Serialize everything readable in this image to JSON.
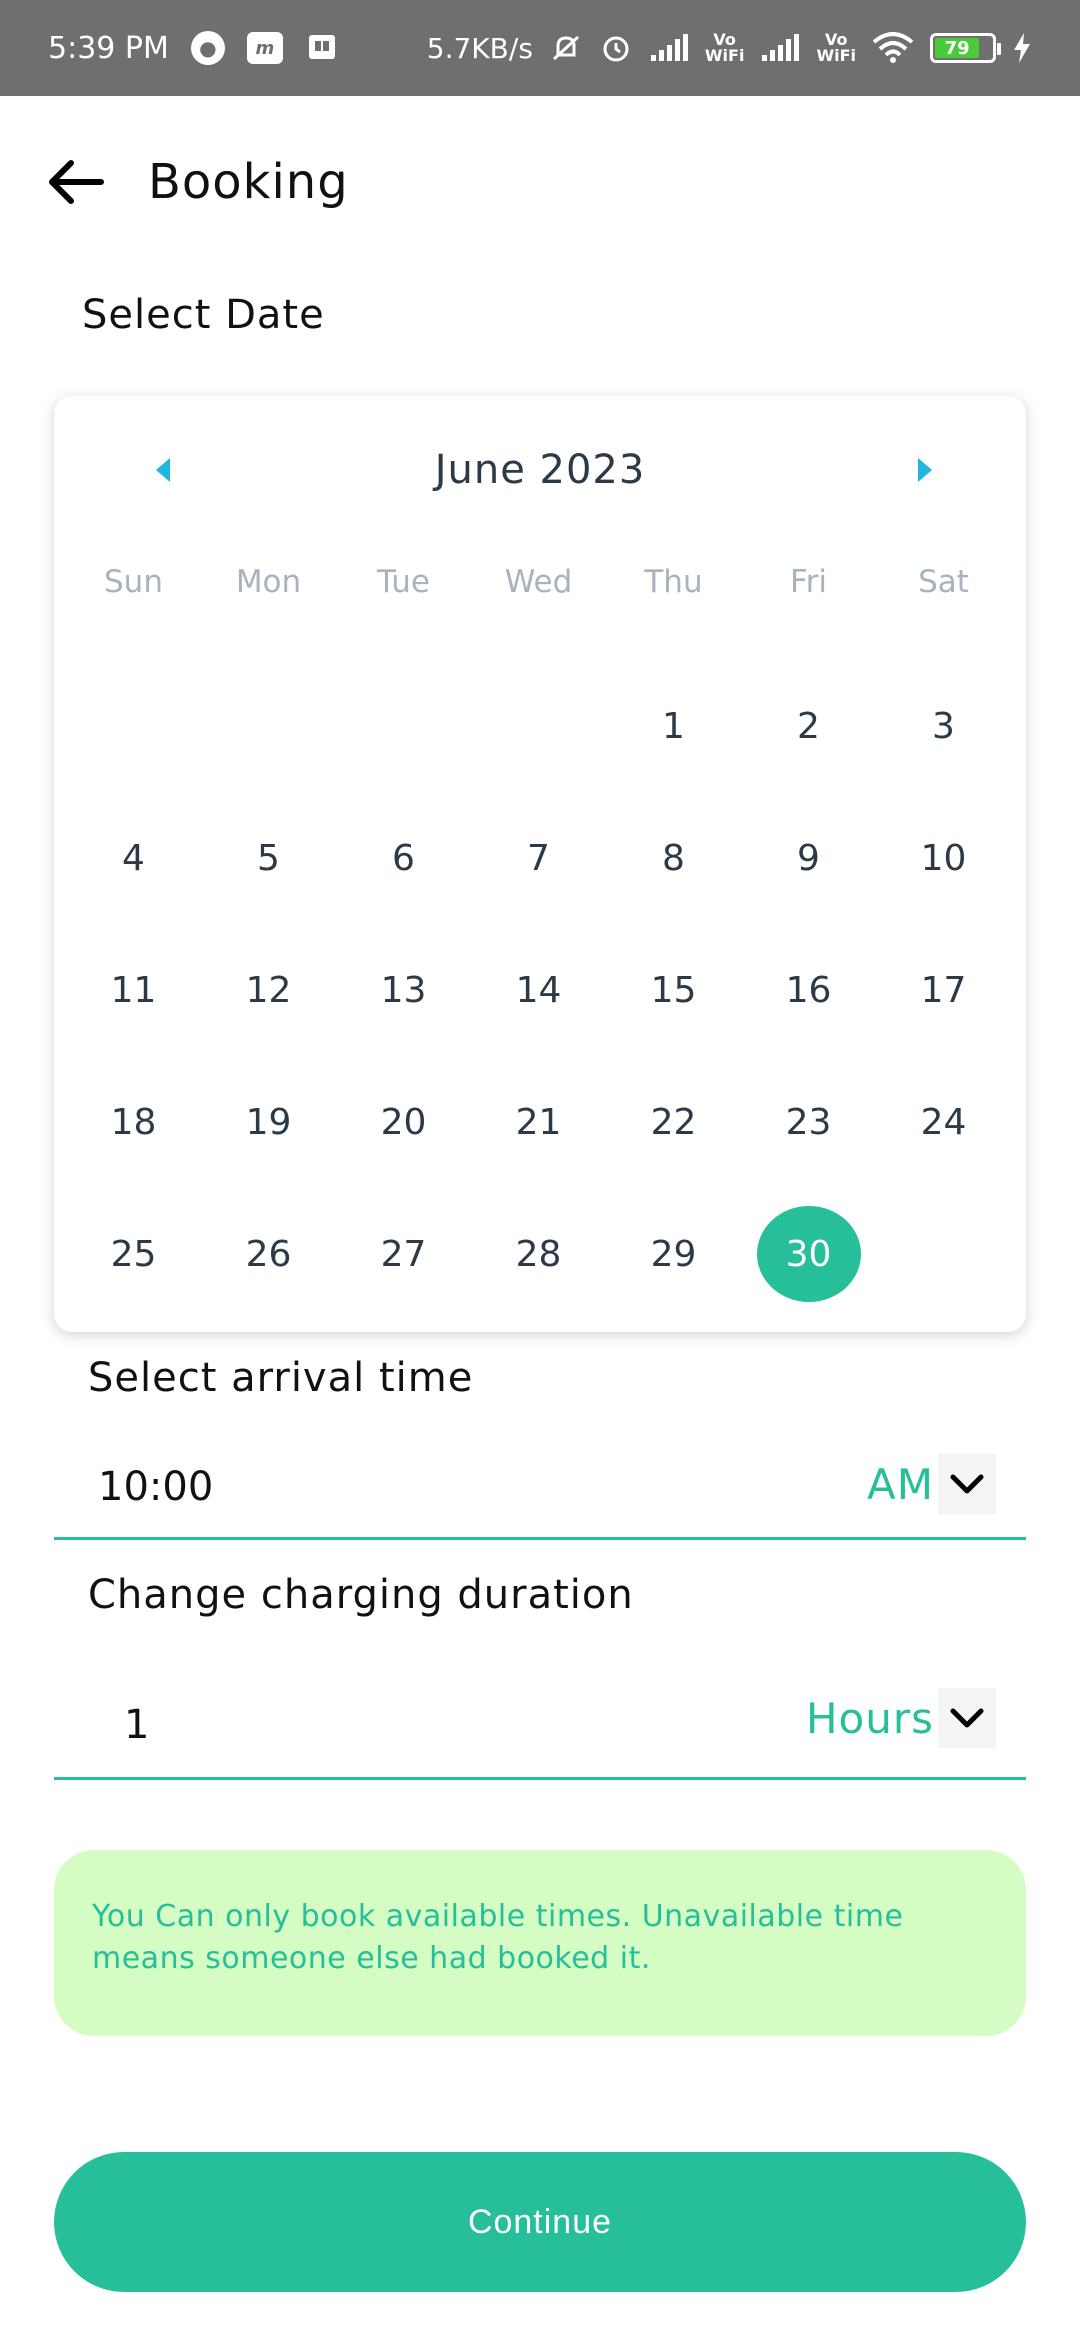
{
  "status_bar": {
    "time": "5:39 PM",
    "app_badge_1": "m",
    "net_speed": "5.7KB/s",
    "vowifi_1": "Vo\nWiFi",
    "vowifi_2": "Vo\nWiFi",
    "battery_level": "79"
  },
  "header": {
    "title": "Booking"
  },
  "date_section": {
    "label": "Select Date"
  },
  "calendar": {
    "month_label": "June 2023",
    "weekdays": [
      "Sun",
      "Mon",
      "Tue",
      "Wed",
      "Thu",
      "Fri",
      "Sat"
    ],
    "first_weekday_index": 4,
    "days": [
      "1",
      "2",
      "3",
      "4",
      "5",
      "6",
      "7",
      "8",
      "9",
      "10",
      "11",
      "12",
      "13",
      "14",
      "15",
      "16",
      "17",
      "18",
      "19",
      "20",
      "21",
      "22",
      "23",
      "24",
      "25",
      "26",
      "27",
      "28",
      "29",
      "30"
    ],
    "selected_day": "30",
    "accent_color": "#26bf99",
    "nav_color": "#1fb6e0"
  },
  "arrival": {
    "label": "Select arrival time",
    "value": "10:00",
    "period": "AM"
  },
  "duration": {
    "label": "Change charging duration",
    "value": "1",
    "unit": "Hours"
  },
  "info": {
    "text": "You Can only book available times. Unavailable time means someone else had booked it."
  },
  "actions": {
    "continue_label": "Continue"
  }
}
